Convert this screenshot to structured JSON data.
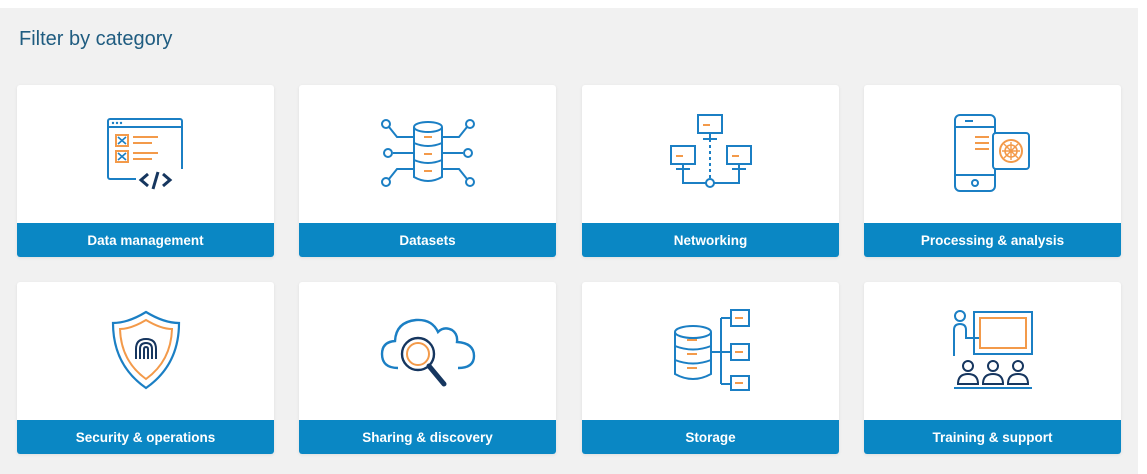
{
  "header": {
    "title": "Filter by category"
  },
  "colors": {
    "accent": "#0a87c4",
    "icon_blue": "#1b7fc4",
    "icon_orange": "#f39a4a",
    "panel_bg": "#f1f1f1",
    "title": "#1f5c80"
  },
  "categories": [
    {
      "label": "Data management",
      "icon": "code-window-icon"
    },
    {
      "label": "Datasets",
      "icon": "database-network-icon"
    },
    {
      "label": "Networking",
      "icon": "network-computers-icon"
    },
    {
      "label": "Processing & analysis",
      "icon": "mobile-processing-icon"
    },
    {
      "label": "Security & operations",
      "icon": "fingerprint-shield-icon"
    },
    {
      "label": "Sharing & discovery",
      "icon": "cloud-search-icon"
    },
    {
      "label": "Storage",
      "icon": "database-hierarchy-icon"
    },
    {
      "label": "Training & support",
      "icon": "presentation-training-icon"
    }
  ]
}
